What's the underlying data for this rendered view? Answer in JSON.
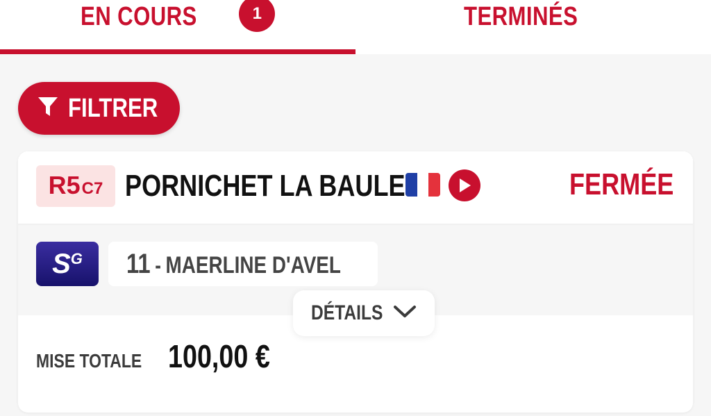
{
  "tabs": [
    {
      "label": "EN COURS",
      "badge": "1",
      "active": true
    },
    {
      "label": "TERMINÉS",
      "active": false
    }
  ],
  "filter": {
    "label": "FILTRER",
    "icon": "filter-icon"
  },
  "race": {
    "reunion": "R5",
    "course": "C7",
    "name": "PORNICHET LA BAULE",
    "flag": "france-flag",
    "status": "FERMÉE"
  },
  "bet": {
    "type_badge": {
      "s": "S",
      "g": "G"
    },
    "horse_number": "11",
    "separator": "-",
    "horse_name": "MAERLINE D'AVEL"
  },
  "details": {
    "label": "DÉTAILS",
    "icon": "chevron-down-icon"
  },
  "total": {
    "label": "MISE TOTALE",
    "value": "100,00 €"
  },
  "colors": {
    "accent": "#c8102e",
    "badge_bg": "#fbe3e3",
    "sg_dark": "#17126b"
  }
}
